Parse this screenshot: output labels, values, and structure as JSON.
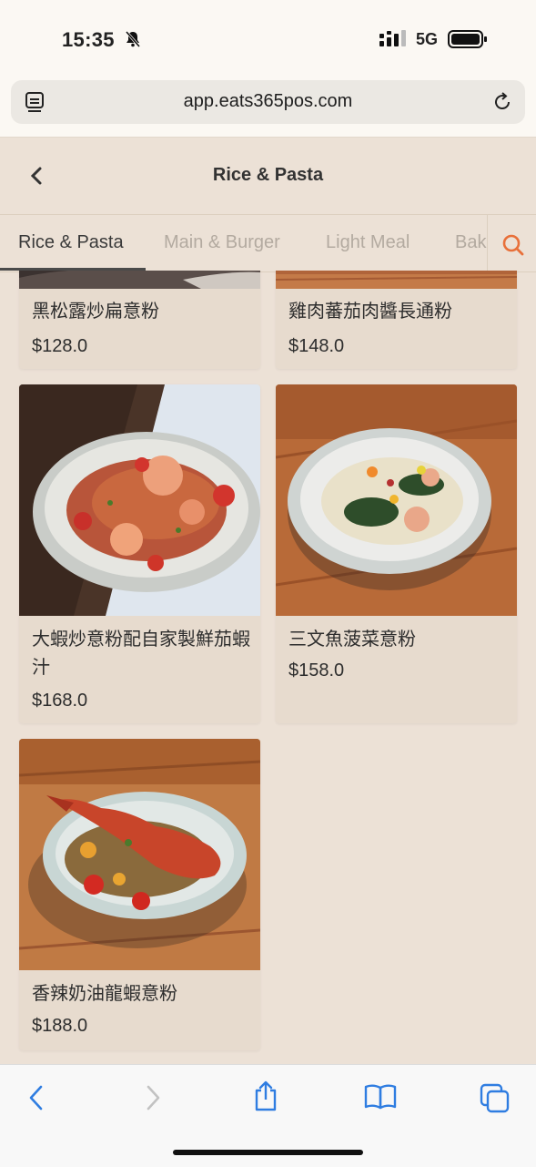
{
  "status": {
    "time": "15:35",
    "network": "5G"
  },
  "browser": {
    "url": "app.eats365pos.com"
  },
  "header": {
    "title": "Rice & Pasta"
  },
  "tabs": [
    {
      "label": "Rice & Pasta",
      "active": true
    },
    {
      "label": "Main & Burger",
      "active": false
    },
    {
      "label": "Light Meal",
      "active": false
    },
    {
      "label": "Bak",
      "active": false
    }
  ],
  "items": [
    {
      "name": "黑松露炒扁意粉",
      "price": "$128.0"
    },
    {
      "name": "雞肉蕃茄肉醬長通粉",
      "price": "$148.0"
    },
    {
      "name": "大蝦炒意粉配自家製鮮茄蝦汁",
      "price": "$168.0"
    },
    {
      "name": "三文魚菠菜意粉",
      "price": "$158.0"
    },
    {
      "name": "香辣奶油龍蝦意粉",
      "price": "$188.0"
    }
  ],
  "colors": {
    "accent": "#e8703a",
    "link": "#2f7de1",
    "background": "#ece1d6"
  },
  "icons": [
    "bell-slash-icon",
    "signal-icon",
    "battery-icon",
    "tab-overview-icon",
    "reload-icon",
    "chevron-left-icon",
    "search-icon",
    "share-icon",
    "book-icon",
    "tabs-icon"
  ]
}
